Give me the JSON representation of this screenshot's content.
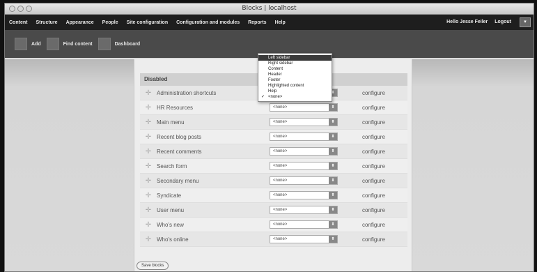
{
  "window": {
    "title": "Blocks | localhost"
  },
  "toolbar": {
    "nav": [
      "Content",
      "Structure",
      "Appearance",
      "People",
      "Site configuration",
      "Configuration and modules",
      "Reports",
      "Help"
    ],
    "greeting": "Hello Jesse Feiler",
    "logout": "Logout",
    "toggle": "▾"
  },
  "shortcuts": [
    "Add",
    "Find content",
    "Dashboard"
  ],
  "blocks": {
    "section_title": "Disabled",
    "configure_label": "configure",
    "region_value": "<none>",
    "rows": [
      "Administration shortcuts",
      "HR Resources",
      "Main menu",
      "Recent blog posts",
      "Recent comments",
      "Search form",
      "Secondary menu",
      "Syndicate",
      "User menu",
      "Who's new",
      "Who's online"
    ]
  },
  "dropdown": {
    "options": [
      "Left sidebar",
      "Right sidebar",
      "Content",
      "Header",
      "Footer",
      "Highlighted content",
      "Help",
      "<none>"
    ],
    "highlighted": "Left sidebar",
    "checked": "<none>"
  },
  "save_button": "Save blocks",
  "colors": {
    "toolbar": "#1e1e1e",
    "shortcuts": "#4a4a4a",
    "highlight": "#3a3a3a"
  }
}
